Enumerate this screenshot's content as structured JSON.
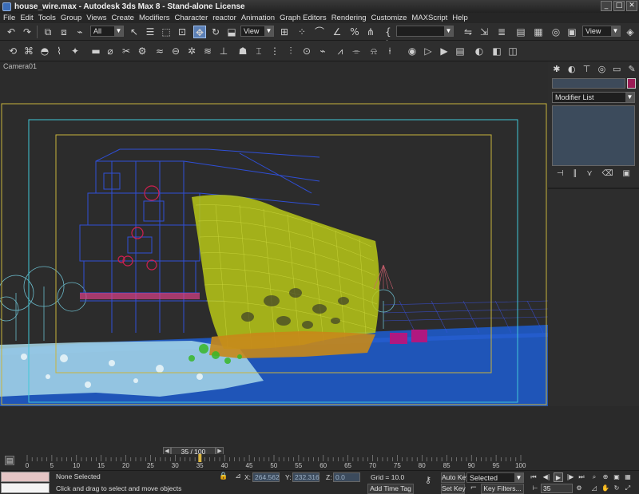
{
  "window": {
    "title": "house_wire.max - Autodesk 3ds Max 8 - Stand-alone License",
    "minimize": "_",
    "maximize": "□",
    "close": "✕"
  },
  "menu": [
    "File",
    "Edit",
    "Tools",
    "Group",
    "Views",
    "Create",
    "Modifiers",
    "Character",
    "reactor",
    "Animation",
    "Graph Editors",
    "Rendering",
    "Customize",
    "MAXScript",
    "Help"
  ],
  "toolbar": {
    "selection_filter": "All",
    "ref_coord": "View",
    "named_selection": "",
    "view_right": "View"
  },
  "viewport": {
    "label": "Camera01",
    "active_tool": "select-and-move"
  },
  "command_panel": {
    "modifier_list": "Modifier List",
    "object_color": "#9c1c56"
  },
  "timeline": {
    "frame_display": "35 / 100",
    "current_frame": 35,
    "total_frames": 100,
    "ticks": [
      "0",
      "5",
      "10",
      "15",
      "20",
      "25",
      "30",
      "35",
      "40",
      "45",
      "50",
      "55",
      "60",
      "65",
      "70",
      "75",
      "80",
      "85",
      "90",
      "95",
      "100"
    ]
  },
  "status": {
    "selection": "None Selected",
    "prompt": "Click and drag to select and move objects",
    "x_label": "X:",
    "x_value": "264.562",
    "y_label": "Y:",
    "y_value": "232.316",
    "z_label": "Z:",
    "z_value": "0.0",
    "grid": "Grid = 10.0",
    "add_time_tag": "Add Time Tag",
    "auto_key": "Auto Key",
    "key_mode": "Selected",
    "set_key": "Set Key",
    "key_filters": "Key Filters...",
    "frame_field": "35"
  },
  "colors": {
    "accent_active": "#5b7fb5",
    "wire_blue": "#2f4fd8",
    "wire_yellow": "#c8d820",
    "ground_blue": "#1e5ac8",
    "safe_frame_yellow": "#c8b43c",
    "safe_frame_cyan": "#40c8d8"
  }
}
